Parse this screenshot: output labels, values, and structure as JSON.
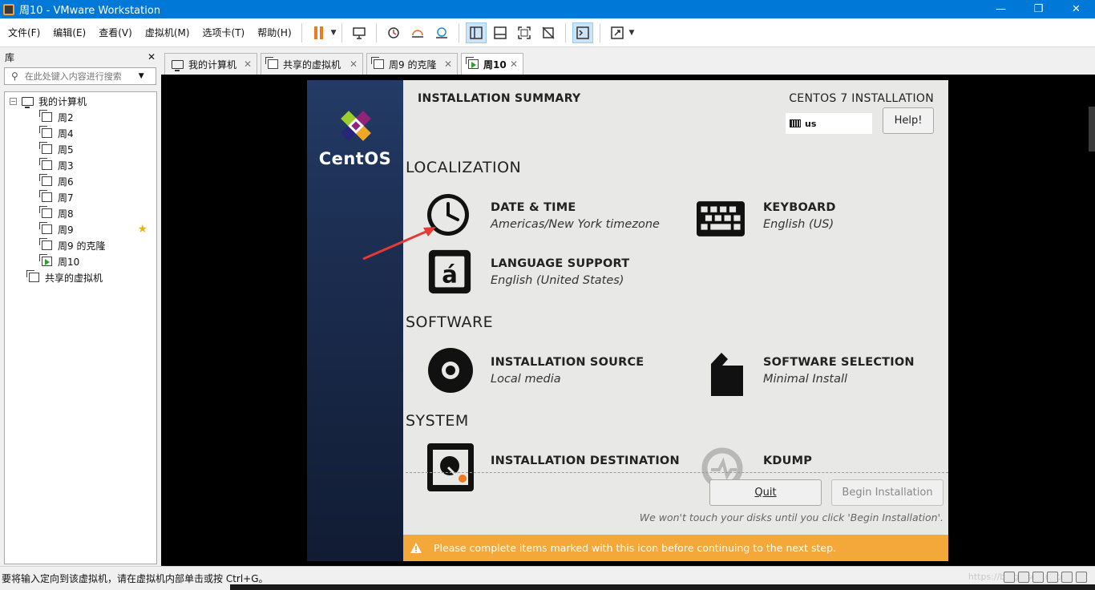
{
  "window": {
    "title": "周10 - VMware Workstation",
    "minimize": "—",
    "maximize": "❐",
    "close": "✕"
  },
  "menu": [
    "文件(F)",
    "编辑(E)",
    "查看(V)",
    "虚拟机(M)",
    "选项卡(T)",
    "帮助(H)"
  ],
  "library": {
    "title": "库",
    "close": "✕",
    "search_placeholder": "在此处键入内容进行搜索",
    "tree": {
      "root": "我的计算机",
      "vms": [
        "周2",
        "周4",
        "周5",
        "周3",
        "周6",
        "周7",
        "周8",
        "周9",
        "周9 的克隆",
        "周10"
      ],
      "shared": "共享的虚拟机"
    }
  },
  "tabs": [
    {
      "label": "我的计算机"
    },
    {
      "label": "共享的虚拟机"
    },
    {
      "label": "周9 的克隆"
    },
    {
      "label": "周10"
    }
  ],
  "installer": {
    "brand": "CentOS",
    "header_title": "INSTALLATION SUMMARY",
    "product": "CENTOS 7 INSTALLATION",
    "keyboard_layout": "us",
    "help_label": "Help!",
    "sections": {
      "localization": "LOCALIZATION",
      "software": "SOFTWARE",
      "system": "SYSTEM"
    },
    "spokes": {
      "datetime": {
        "title": "DATE & TIME",
        "status": "Americas/New York timezone"
      },
      "keyboard": {
        "title": "KEYBOARD",
        "status": "English (US)"
      },
      "language": {
        "title": "LANGUAGE SUPPORT",
        "status": "English (United States)"
      },
      "source": {
        "title": "INSTALLATION SOURCE",
        "status": "Local media"
      },
      "selection": {
        "title": "SOFTWARE SELECTION",
        "status": "Minimal Install"
      },
      "destination": {
        "title": "INSTALLATION DESTINATION",
        "status": ""
      },
      "kdump": {
        "title": "KDUMP",
        "status": ""
      }
    },
    "quit_label": "Quit",
    "begin_label": "Begin Installation",
    "note": "We won't touch your disks until you click 'Begin Installation'.",
    "warning": "Please complete items marked with this icon before continuing to the next step."
  },
  "statusbar": {
    "message": "要将输入定向到该虚拟机，请在虚拟机内部单击或按 Ctrl+G。",
    "watermark": "https://blog.csdn.net/..."
  },
  "colors": {
    "titlebar": "#0078d7",
    "accent_pause": "#f07b1d",
    "warning_bar": "#f5a83a",
    "sidebar_dark": "#1b2c4e",
    "annotation_arrow": "#e53935"
  }
}
